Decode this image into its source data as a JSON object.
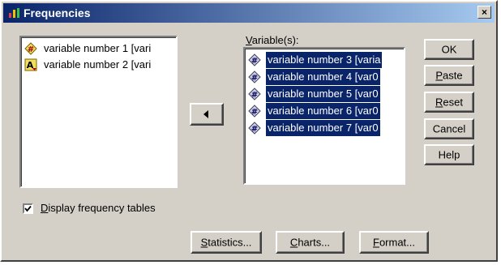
{
  "window": {
    "title": "Frequencies",
    "close_label": "×"
  },
  "source_list": {
    "items": [
      {
        "label": "variable number 1 [vari",
        "icon": "numeric-variable-icon"
      },
      {
        "label": "variable number 2 [vari",
        "icon": "string-variable-icon"
      }
    ]
  },
  "variables": {
    "label_underlined": "V",
    "label_rest": "ariable(s):",
    "items": [
      {
        "label": "variable number 3 [varia",
        "icon": "numeric-variable-icon",
        "selected": true
      },
      {
        "label": "variable number 4 [var0",
        "icon": "numeric-variable-icon",
        "selected": true
      },
      {
        "label": "variable number 5 [var0",
        "icon": "numeric-variable-icon",
        "selected": true
      },
      {
        "label": "variable number 6 [var0",
        "icon": "numeric-variable-icon",
        "selected": true
      },
      {
        "label": "variable number 7 [var0",
        "icon": "numeric-variable-icon",
        "selected": true
      }
    ]
  },
  "move_button": {
    "icon": "left-arrow-icon"
  },
  "side_buttons": {
    "ok": "OK",
    "paste_u": "P",
    "paste_rest": "aste",
    "reset_u": "R",
    "reset_rest": "eset",
    "cancel": "Cancel",
    "help": "Help"
  },
  "display_tables": {
    "checked": true,
    "label_underlined": "D",
    "label_rest": "isplay frequency tables"
  },
  "bottom_buttons": {
    "statistics_u": "S",
    "statistics_rest": "tatistics...",
    "charts_u": "C",
    "charts_rest": "harts...",
    "format_u": "F",
    "format_rest": "ormat..."
  },
  "colors": {
    "selection": "#0a246a",
    "face": "#d4d0c8"
  }
}
